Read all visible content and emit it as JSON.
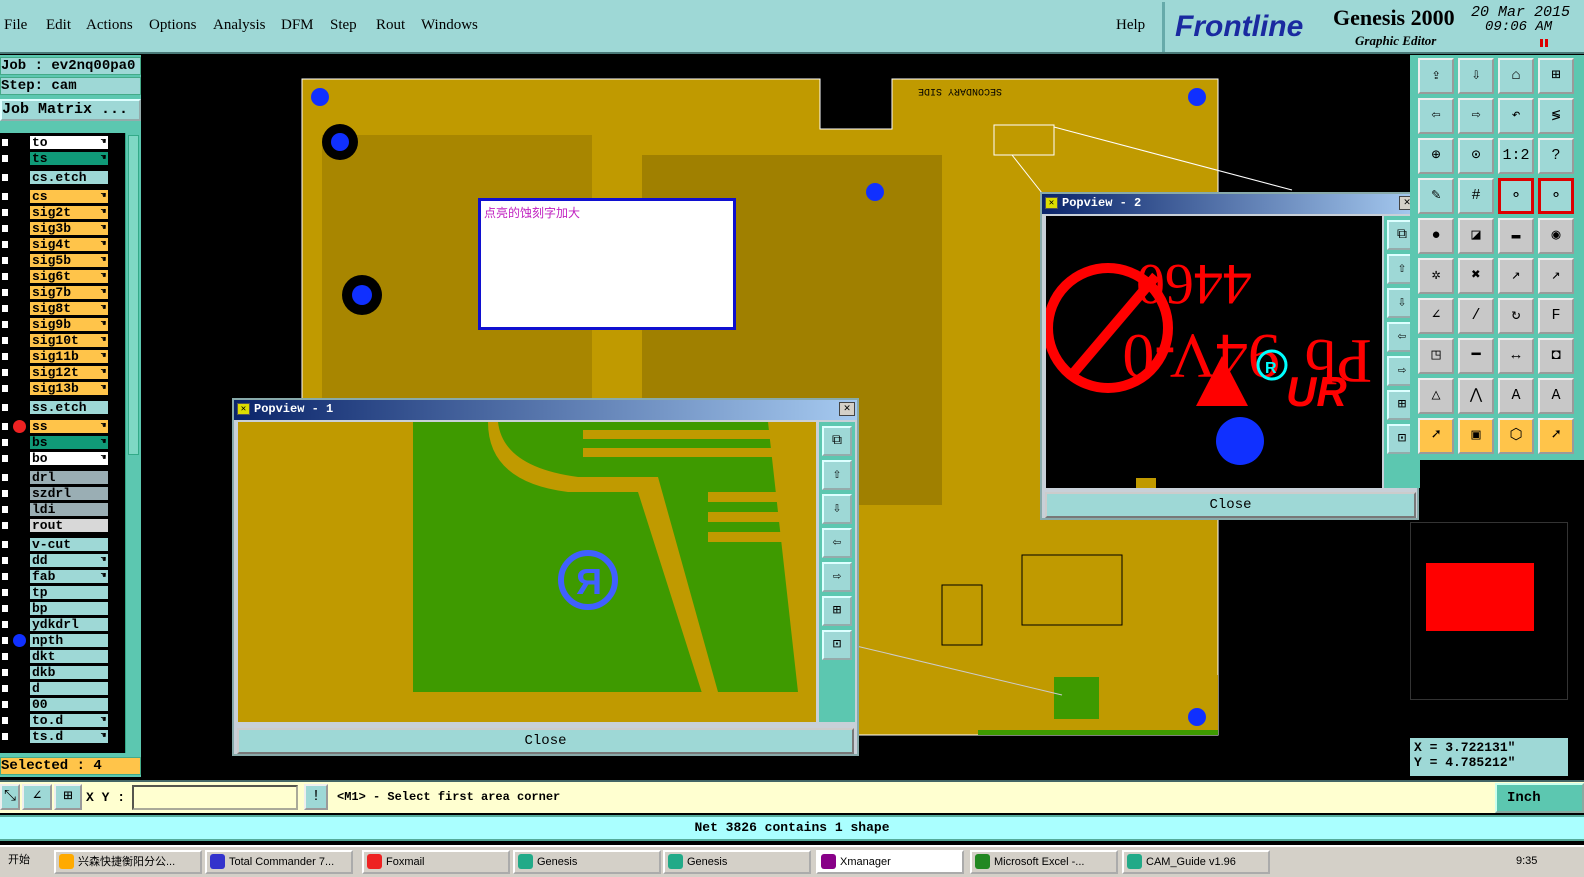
{
  "menu": [
    "File",
    "Edit",
    "Actions",
    "Options",
    "Analysis",
    "DFM",
    "Step",
    "Rout",
    "Windows"
  ],
  "help": "Help",
  "logo": {
    "brand": "Frontline",
    "product": "Genesis 2000",
    "subtitle": "Graphic Editor",
    "date": "20 Mar 2015",
    "time": "09:06 AM"
  },
  "job": {
    "job": "Job : ev2nq00pa0",
    "step": "Step: cam",
    "matrix": "Job Matrix ..."
  },
  "layers": [
    {
      "n": "to",
      "c": "#ffffff",
      "h": true
    },
    {
      "n": "ts",
      "c": "#109a78",
      "h": true
    },
    {
      "n": "cs.etch",
      "c": "#9ed8d6",
      "h": false,
      "gap": true
    },
    {
      "n": "cs",
      "c": "#ffc44a",
      "h": true,
      "gap": true
    },
    {
      "n": "sig2t",
      "c": "#ffc44a",
      "h": true
    },
    {
      "n": "sig3b",
      "c": "#ffc44a",
      "h": true
    },
    {
      "n": "sig4t",
      "c": "#ffc44a",
      "h": true
    },
    {
      "n": "sig5b",
      "c": "#ffc44a",
      "h": true
    },
    {
      "n": "sig6t",
      "c": "#ffc44a",
      "h": true
    },
    {
      "n": "sig7b",
      "c": "#ffc44a",
      "h": true
    },
    {
      "n": "sig8t",
      "c": "#ffc44a",
      "h": true
    },
    {
      "n": "sig9b",
      "c": "#ffc44a",
      "h": true
    },
    {
      "n": "sig10t",
      "c": "#ffc44a",
      "h": true
    },
    {
      "n": "sig11b",
      "c": "#ffc44a",
      "h": true
    },
    {
      "n": "sig12t",
      "c": "#ffc44a",
      "h": true
    },
    {
      "n": "sig13b",
      "c": "#ffc44a",
      "h": true
    },
    {
      "n": "ss.etch",
      "c": "#9ed8d6",
      "h": false,
      "gap": true
    },
    {
      "n": "ss",
      "c": "#ffc44a",
      "h": true,
      "gap": true,
      "work": true
    },
    {
      "n": "bs",
      "c": "#109a78",
      "h": true
    },
    {
      "n": "bo",
      "c": "#ffffff",
      "h": true
    },
    {
      "n": "drl",
      "c": "#9aaeb4",
      "h": false,
      "gap": true
    },
    {
      "n": "szdrl",
      "c": "#9aaeb4",
      "h": false
    },
    {
      "n": "ldi",
      "c": "#9aaeb4",
      "h": false
    },
    {
      "n": "rout",
      "c": "#d8d8d8",
      "h": false
    },
    {
      "n": "v-cut",
      "c": "#9ed8d6",
      "h": false,
      "gap": true
    },
    {
      "n": "dd",
      "c": "#9ed8d6",
      "h": true
    },
    {
      "n": "fab",
      "c": "#9ed8d6",
      "h": true
    },
    {
      "n": "tp",
      "c": "#9ed8d6",
      "h": false
    },
    {
      "n": "bp",
      "c": "#9ed8d6",
      "h": false
    },
    {
      "n": "ydkdrl",
      "c": "#9ed8d6",
      "h": false
    },
    {
      "n": "npth",
      "c": "#9ed8d6",
      "h": false,
      "dot": true
    },
    {
      "n": "dkt",
      "c": "#9ed8d6",
      "h": false
    },
    {
      "n": "dkb",
      "c": "#9ed8d6",
      "h": false
    },
    {
      "n": "d",
      "c": "#9ed8d6",
      "h": false
    },
    {
      "n": "00",
      "c": "#9ed8d6",
      "h": false
    },
    {
      "n": "to.d",
      "c": "#9ed8d6",
      "h": true
    },
    {
      "n": "ts.d",
      "c": "#9ed8d6",
      "h": true
    }
  ],
  "selected": "Selected : 4",
  "note": "点亮的蚀刻字加大",
  "board_label": "SECONDARY SIDE",
  "popview1": {
    "title": "Popview - 1",
    "close": "Close"
  },
  "popview2": {
    "title": "Popview - 2",
    "close": "Close",
    "marks": [
      "4460",
      "94V-0",
      "Pb",
      "UR"
    ]
  },
  "coords": {
    "x": "X = 3.722131\"",
    "y": "Y = 4.785212\""
  },
  "cmd": {
    "xy_label": "X Y :",
    "xy_value": "",
    "prompt": "<M1> - Select first area corner",
    "units": "Inch"
  },
  "status": "Net 3826 contains 1 shape",
  "taskbar": {
    "start": "开始",
    "tasks": [
      "兴森快捷衡阳分公...",
      "Total Commander 7...",
      "Foxmail",
      "Genesis",
      "Genesis",
      "Xmanager",
      "Microsoft Excel -...",
      "CAM_Guide v1.96"
    ],
    "clock": "9:35"
  },
  "colors": {
    "panel": "#9ed8d6",
    "board": "#c09a00",
    "canvas": "#000000",
    "green": "#3e9a00"
  }
}
